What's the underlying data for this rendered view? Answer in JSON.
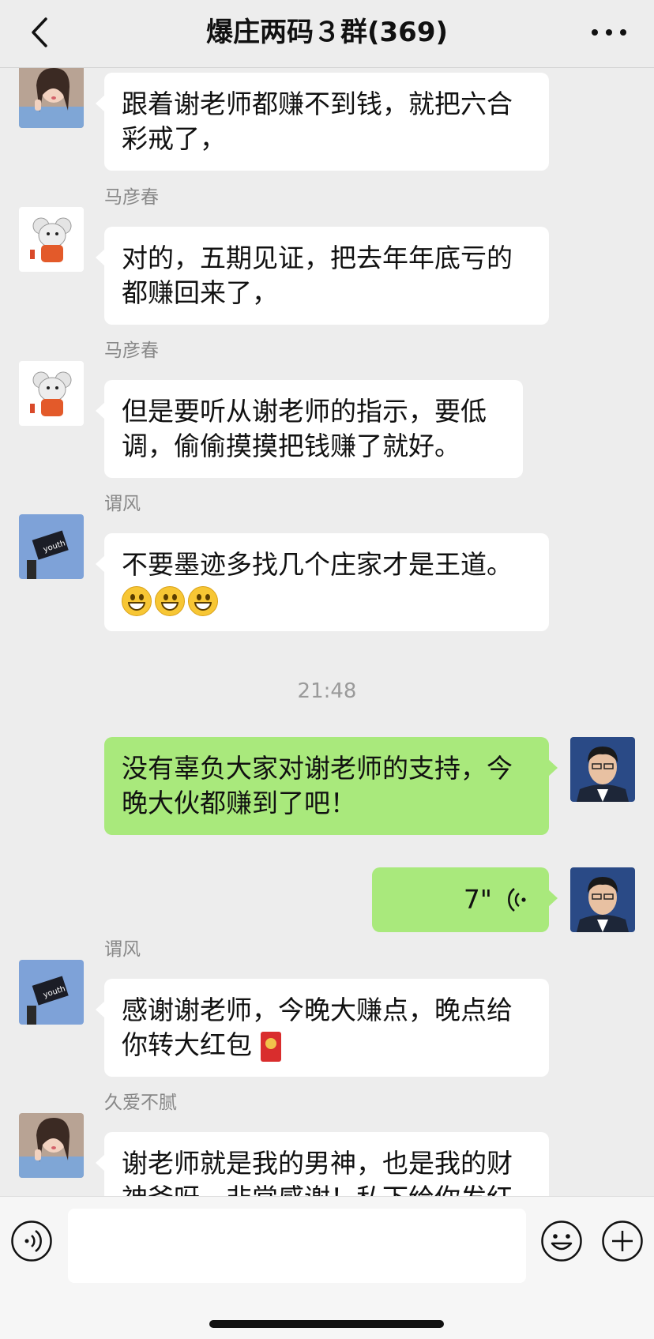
{
  "header": {
    "title": "爆庄两码３群(369)"
  },
  "messages": [
    {
      "type": "in",
      "sender": "",
      "text": "跟着谢老师都赚不到钱，就把六合彩戒了，"
    },
    {
      "type": "in",
      "sender": "马彦春",
      "text": "对的，五期见证，把去年年底亏的都赚回来了，"
    },
    {
      "type": "in",
      "sender": "马彦春",
      "text": "但是要听从谢老师的指示，要低调，偷偷摸摸把钱赚了就好。"
    },
    {
      "type": "in",
      "sender": "谓风",
      "text": "不要墨迹多找几个庄家才是王道。"
    },
    {
      "type": "time",
      "text": "21:48"
    },
    {
      "type": "out",
      "text": "没有辜负大家对谢老师的支持，今晚大伙都赚到了吧！"
    },
    {
      "type": "out-voice",
      "duration": "7\""
    },
    {
      "type": "in",
      "sender": "谓风",
      "text": "感谢谢老师，今晚大赚点，晚点给你转大红包"
    },
    {
      "type": "in",
      "sender": "久爱不腻",
      "text": "谢老师就是我的男神，也是我的财神爷呀，非常感谢！私下给你发红"
    }
  ],
  "icons": {
    "back": "chevron-left-icon",
    "more": "more-horizontal-icon",
    "voice": "voice-icon",
    "emoji": "smile-icon",
    "plus": "plus-icon",
    "grin": "grinning-emoji",
    "red_packet": "red-packet-emoji"
  },
  "colors": {
    "background": "#ededed",
    "bubble_in": "#ffffff",
    "bubble_out": "#a9e97c"
  }
}
